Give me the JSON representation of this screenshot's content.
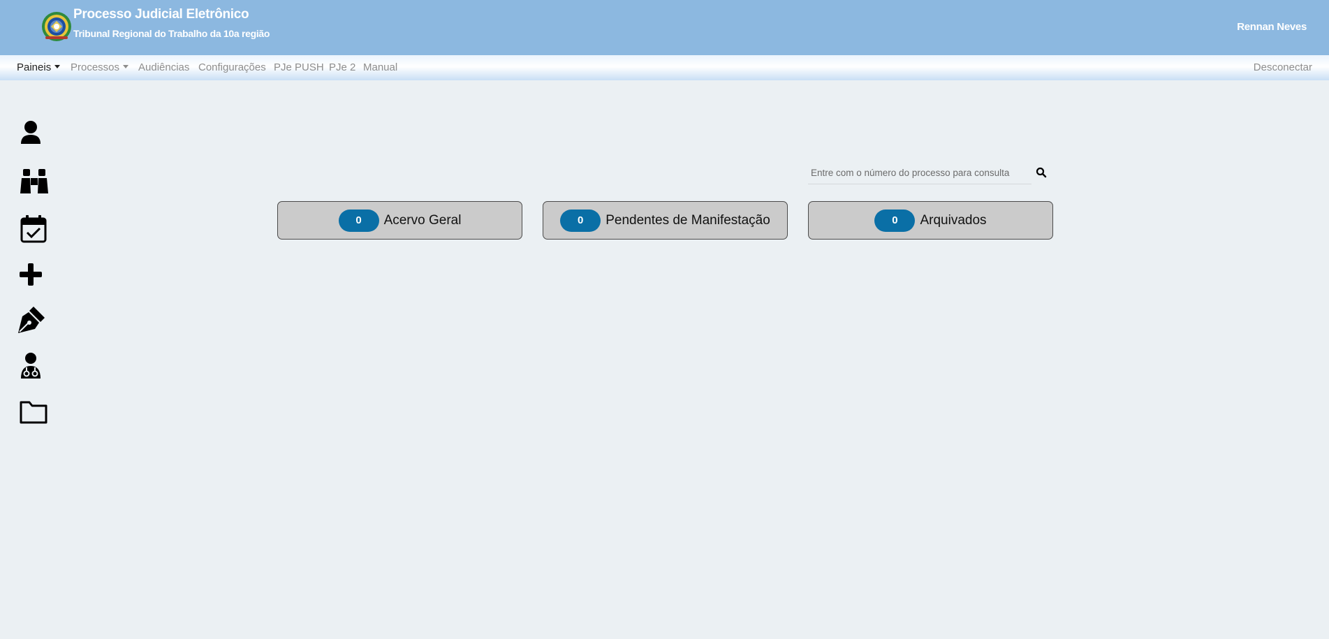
{
  "header": {
    "title": "Processo Judicial Eletrônico",
    "subtitle": "Tribunal Regional do Trabalho da 10a região",
    "user_name": "Rennan Neves",
    "logo_icon": "brasil-coat-of-arms-icon",
    "background_color": "#8cb8e0"
  },
  "nav": {
    "items": [
      {
        "label": "Paineis",
        "dropdown": true,
        "active": true
      },
      {
        "label": "Processos",
        "dropdown": true,
        "active": false
      },
      {
        "label": "Audiências",
        "dropdown": false,
        "active": false
      },
      {
        "label": "Configurações",
        "dropdown": false,
        "active": false
      },
      {
        "label": "PJe PUSH",
        "dropdown": false,
        "active": false
      },
      {
        "label": "PJe 2",
        "dropdown": false,
        "active": false
      },
      {
        "label": "Manual",
        "dropdown": false,
        "active": false
      }
    ],
    "logout_label": "Desconectar"
  },
  "sidebar": {
    "icons": [
      "user-icon",
      "binoculars-icon",
      "calendar-check-icon",
      "plus-icon",
      "pen-nib-icon",
      "user-doctor-icon",
      "folder-icon"
    ]
  },
  "search": {
    "placeholder": "Entre com o número do processo para consulta",
    "value": "",
    "icon": "search-icon"
  },
  "cards": [
    {
      "count": "0",
      "label": "Acervo Geral"
    },
    {
      "count": "0",
      "label": "Pendentes de Manifestação"
    },
    {
      "count": "0",
      "label": "Arquivados"
    }
  ],
  "colors": {
    "badge": "#0a6fa6",
    "card_background": "#cbcbcb",
    "page_background": "#ebf0f3"
  }
}
